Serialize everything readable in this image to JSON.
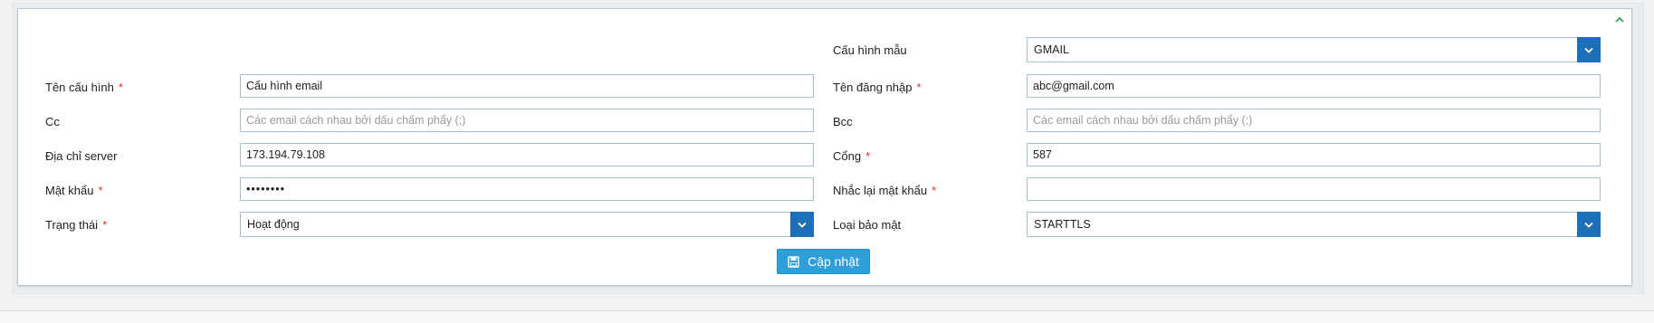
{
  "form": {
    "fields": {
      "template": {
        "label": "Cấu hình mẫu",
        "value": "GMAIL"
      },
      "name": {
        "label": "Tên cấu hình",
        "required_mark": "*",
        "value": "Cấu hình email"
      },
      "username": {
        "label": "Tên đăng nhập",
        "required_mark": "*",
        "value": "abc@gmail.com"
      },
      "cc": {
        "label": "Cc",
        "placeholder": "Các email cách nhau bởi dấu chấm phẩy (;)"
      },
      "bcc": {
        "label": "Bcc",
        "placeholder": "Các email cách nhau bởi dấu chấm phẩy (;)"
      },
      "server": {
        "label": "Địa chỉ server",
        "value": "173.194.79.108"
      },
      "port": {
        "label": "Cổng",
        "required_mark": "*",
        "value": "587"
      },
      "password": {
        "label": "Mật khẩu",
        "required_mark": "*",
        "value": "••••••••"
      },
      "confirm_password": {
        "label": "Nhắc lại mật khẩu",
        "required_mark": "*",
        "value": ""
      },
      "status": {
        "label": "Trạng thái",
        "required_mark": "*",
        "value": "Hoạt động"
      },
      "security": {
        "label": "Loại bảo mật",
        "value": "STARTTLS"
      }
    },
    "submit_label": "Cập nhật"
  },
  "colors": {
    "accent": "#1d6fb8",
    "button": "#2f9fda",
    "required": "#d9302e",
    "collapse": "#3aa04a"
  },
  "icons": {
    "collapse": "chevron-up-icon",
    "submit": "save-icon",
    "dropdown": "chevron-down-icon"
  }
}
